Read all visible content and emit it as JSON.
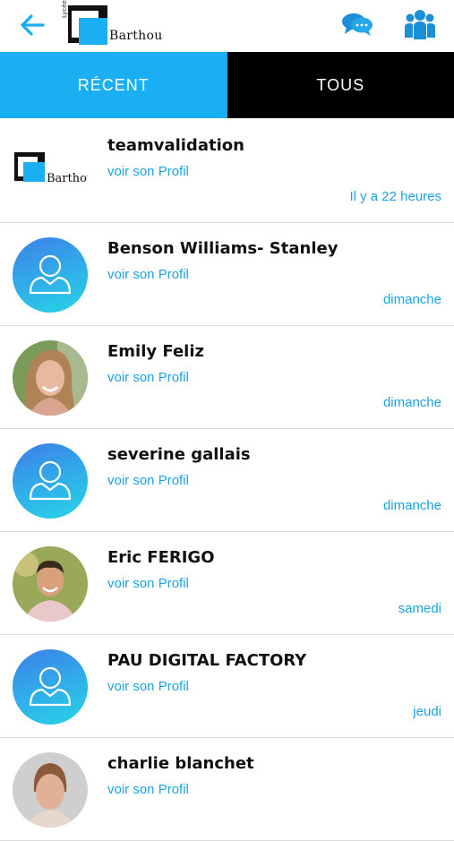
{
  "header": {
    "logo_name": "Barthou",
    "logo_vertical": "Lycée",
    "back_icon": "arrow-left-icon",
    "chat_icon": "chat-bubbles-icon",
    "group_icon": "group-icon",
    "accent_color": "#1aaef2"
  },
  "tabs": [
    {
      "label": "RÉCENT",
      "active": true
    },
    {
      "label": "TOUS",
      "active": false
    }
  ],
  "contacts": [
    {
      "name": "teamvalidation",
      "link": "voir son Profil",
      "time": "Il y a 22 heures",
      "avatar": "school-logo"
    },
    {
      "name": "Benson Williams- Stanley",
      "link": "voir son Profil",
      "time": "dimanche",
      "avatar": "default-user-icon"
    },
    {
      "name": "Emily Feliz",
      "link": "voir son Profil",
      "time": "dimanche",
      "avatar": "photo"
    },
    {
      "name": "severine gallais",
      "link": "voir son Profil",
      "time": "dimanche",
      "avatar": "default-user-icon"
    },
    {
      "name": "Eric FERIGO",
      "link": "voir son Profil",
      "time": "samedi",
      "avatar": "photo"
    },
    {
      "name": "PAU DIGITAL FACTORY",
      "link": "voir son Profil",
      "time": "jeudi",
      "avatar": "default-user-icon"
    },
    {
      "name": "charlie blanchet",
      "link": "voir son Profil",
      "time": "",
      "avatar": "photo"
    }
  ]
}
